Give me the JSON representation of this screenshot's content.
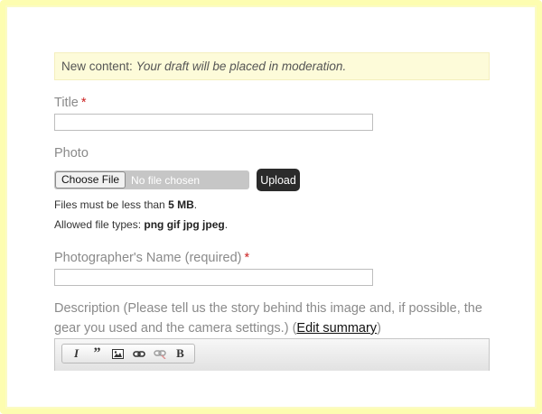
{
  "notice": {
    "prefix": "New content:",
    "message": "Your draft will be placed in moderation."
  },
  "fields": {
    "title": {
      "label": "Title",
      "required_mark": "*",
      "value": ""
    },
    "photo": {
      "label": "Photo",
      "choose_button": "Choose File",
      "no_file_text": "No file chosen",
      "upload_button": "Upload",
      "size_text_before": "Files must be less than",
      "size_limit": "5 MB",
      "size_text_after": ".",
      "types_text_before": "Allowed file types:",
      "types": "png gif jpg jpeg",
      "types_text_after": "."
    },
    "photographer": {
      "label": "Photographer's Name (required)",
      "required_mark": "*",
      "value": ""
    },
    "description": {
      "label": "Description (Please tell us the story behind this image and, if possible, the gear you used and the camera settings.)",
      "open_paren": "(",
      "summary_link": "Edit summary",
      "close_paren": ")"
    }
  },
  "editor_toolbar": {
    "italic": "I",
    "quote": "”",
    "bold": "B",
    "icons": [
      "italic-icon",
      "blockquote-icon",
      "image-icon",
      "link-icon",
      "unlink-icon",
      "bold-icon"
    ]
  },
  "colors": {
    "frame": "#fdfdb0",
    "notice_bg": "#fdfbd9",
    "required": "#cc2222",
    "upload_bg": "#2b2b2b"
  }
}
